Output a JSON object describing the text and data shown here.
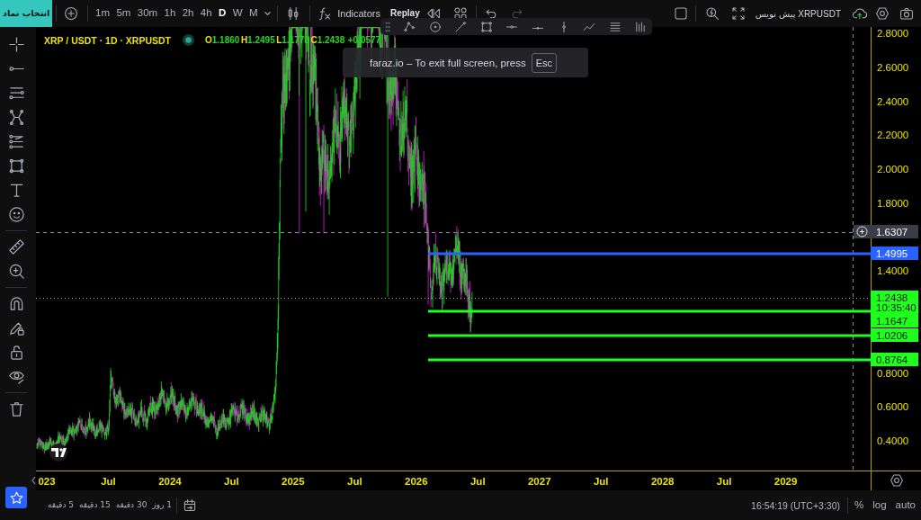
{
  "toolbar": {
    "symbol_search": "انتخاب نماد",
    "intervals": [
      {
        "label": "1m",
        "selected": false
      },
      {
        "label": "5m",
        "selected": false
      },
      {
        "label": "30m",
        "selected": false
      },
      {
        "label": "1h",
        "selected": false
      },
      {
        "label": "2h",
        "selected": false
      },
      {
        "label": "4h",
        "selected": false
      },
      {
        "label": "D",
        "selected": true
      },
      {
        "label": "W",
        "selected": false
      },
      {
        "label": "M",
        "selected": false
      }
    ],
    "indicators": "Indicators",
    "replay": "Replay",
    "history": [
      {
        "kind": "undo",
        "disabled": false
      },
      {
        "kind": "redo",
        "disabled": true
      }
    ],
    "layout_name": "پیش نویس XRPUSDT"
  },
  "legend": {
    "title": "XRP / USDT · 1D · XRPUSDT",
    "ohlc": [
      {
        "key": "O",
        "value": "1.1860"
      },
      {
        "key": "H",
        "value": "1.2495"
      },
      {
        "key": "L",
        "value": "1.1778"
      },
      {
        "key": "C",
        "value": "1.2438"
      }
    ],
    "change": "+0.0577"
  },
  "tooltip": {
    "text": "faraz.io – To exit full screen, press",
    "key": "Esc"
  },
  "price_axis": {
    "ticks": [
      "2.8000",
      "2.6000",
      "2.4000",
      "2.2000",
      "2.0000",
      "1.8000",
      "1.4000",
      "0.8000",
      "0.6000",
      "0.4000"
    ],
    "labels": [
      {
        "kind": "crosshair",
        "text": "1.6307"
      },
      {
        "kind": "drawing",
        "text": "1.4995",
        "color": "#2962ff"
      },
      {
        "kind": "last_price",
        "text": "1.2438",
        "countdown": "10:35:40",
        "color": "#1eff1e"
      },
      {
        "kind": "drawing",
        "text": "1.1647",
        "color": "#1eff1e"
      },
      {
        "kind": "drawing",
        "text": "1.0206",
        "color": "#1eff1e"
      },
      {
        "kind": "drawing",
        "text": "0.8764",
        "color": "#1eff1e"
      }
    ]
  },
  "time_axis": [
    "023",
    "Jul",
    "2024",
    "Jul",
    "2025",
    "Jul",
    "2026",
    "Jul",
    "2027",
    "Jul",
    "2028",
    "Jul",
    "2029"
  ],
  "bottom_bar": {
    "ranges": [
      "1 روز",
      "30 دقیقه",
      "15 دقیقه",
      "5 دقیقه"
    ],
    "clock": "16:54:19 (UTC+3:30)",
    "scale_options": [
      "%",
      "log",
      "auto"
    ]
  }
}
